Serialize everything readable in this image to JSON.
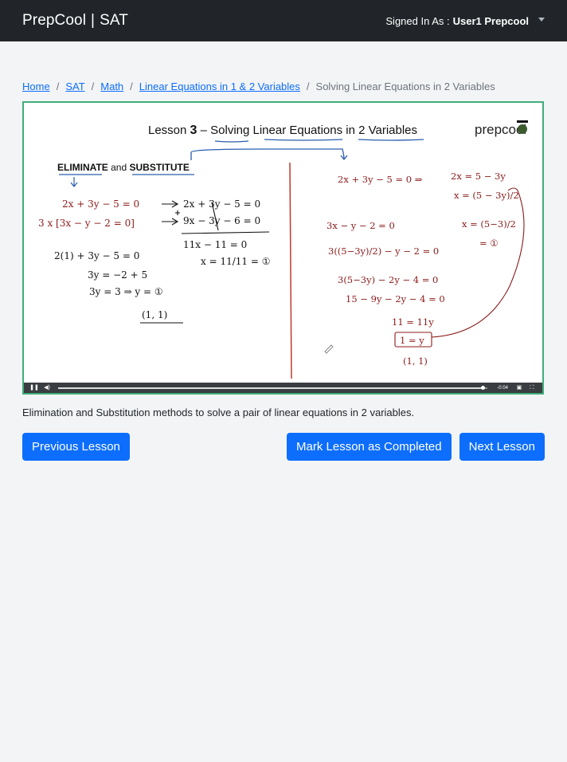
{
  "navbar": {
    "brand_left": "PrepCool",
    "brand_sep": "|",
    "brand_right": "SAT",
    "signed_in_label": "Signed In As :",
    "user_name": "User1 Prepcool"
  },
  "breadcrumb": {
    "items": [
      "Home",
      "SAT",
      "Math",
      "Linear Equations in 1 & 2 Variables"
    ],
    "current": "Solving Linear Equations in 2 Variables"
  },
  "video": {
    "title_prefix": "Lesson",
    "lesson_number": "3",
    "title_suffix": "– Solving Linear Equations in 2 Variables",
    "logo": "prepcool",
    "eliminate": "ELIMINATE",
    "and": "and",
    "substitute": "SUBSTITUTE",
    "left_lines": [
      "2x + 3y − 5 = 0",
      "3 x [3x − y − 2 = 0]",
      "2x + 3y − 5 = 0",
      "9x − 3y − 6 = 0",
      "11x − 11 = 0",
      "x = 11/11 = ①",
      "2(1) + 3y − 5 = 0",
      "3y = −2 + 5",
      "3y = 3 ⇒ y = ①",
      "(1, 1)"
    ],
    "right_lines": [
      "2x + 3y − 5 = 0 ⇒",
      "2x = 5 − 3y",
      "x = (5 − 3y)/2",
      "3x − y − 2 = 0",
      "x = (5−3)/2",
      "= ①",
      "3((5−3y)/2) − y − 2 = 0",
      "3(5−3y) − 2y − 4 = 0",
      "15 − 9y − 2y − 4 = 0",
      "11 = 11y",
      "1 = y",
      "(1, 1)"
    ],
    "progress": 0.99,
    "time": "-0:04"
  },
  "description": "Elimination and Substitution methods to solve a pair of linear equations in 2 variables.",
  "buttons": {
    "previous": "Previous Lesson",
    "complete": "Mark Lesson as Completed",
    "next": "Next Lesson"
  },
  "colors": {
    "navbar": "#212529",
    "primary": "#0d6efd",
    "video_border": "#3fae79",
    "ink_red": "#8b1a1a",
    "ink_blue": "#2a5db0"
  }
}
